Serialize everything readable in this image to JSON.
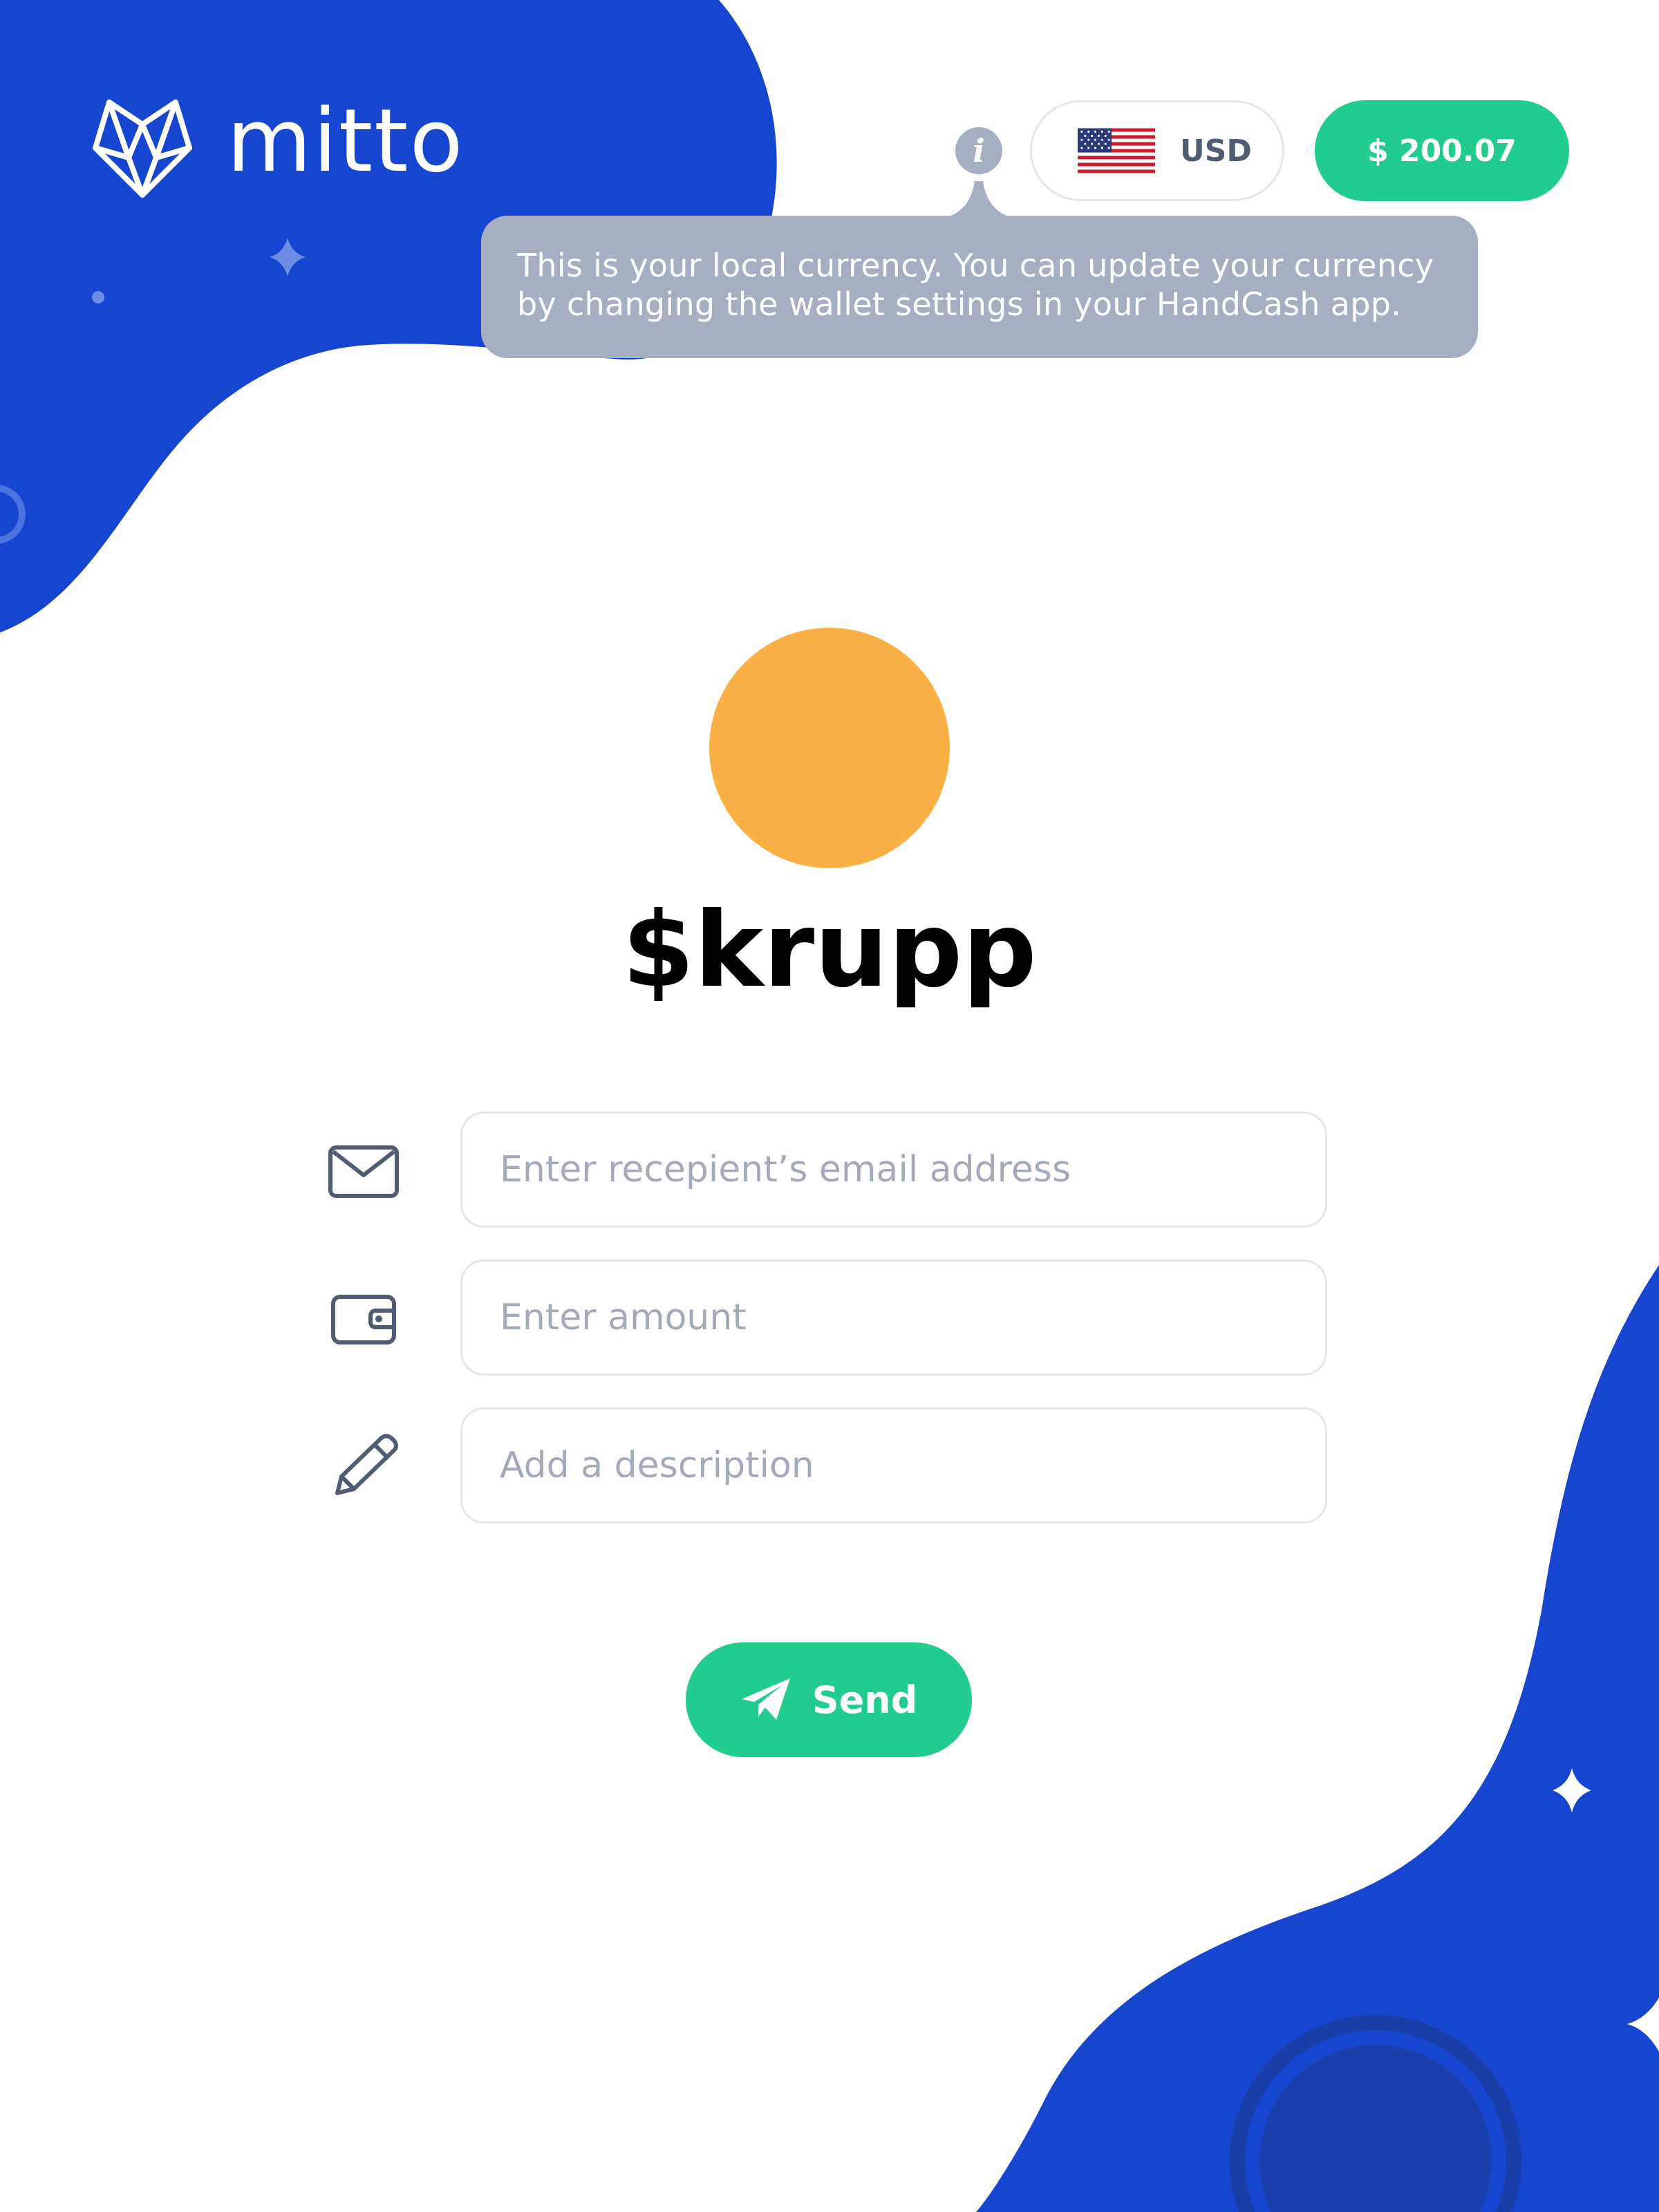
{
  "brand": {
    "name": "mitto",
    "logo_icon": "fox-head-logo",
    "accent_blue": "#1645d0",
    "accent_green": "#22cc8c",
    "avatar_color": "#fab045",
    "tooltip_bg": "#a5afc1"
  },
  "header": {
    "info_icon": "info-icon",
    "info_glyph": "i",
    "currency": {
      "flag": "us-flag-icon",
      "code": "USD"
    },
    "balance": "$ 200.07"
  },
  "tooltip": {
    "line1": "This is your local currency. You can update your currency",
    "line2": "by changing the wallet settings in your HandCash app."
  },
  "recipient": {
    "username": "$krupp"
  },
  "form": {
    "email": {
      "icon": "envelope-icon",
      "placeholder": "Enter recepient’s email address",
      "value": ""
    },
    "amount": {
      "icon": "wallet-icon",
      "placeholder": "Enter amount",
      "value": ""
    },
    "description": {
      "icon": "pencil-icon",
      "placeholder": "Add a description",
      "value": ""
    }
  },
  "send": {
    "icon": "paper-plane-icon",
    "label": "Send"
  }
}
